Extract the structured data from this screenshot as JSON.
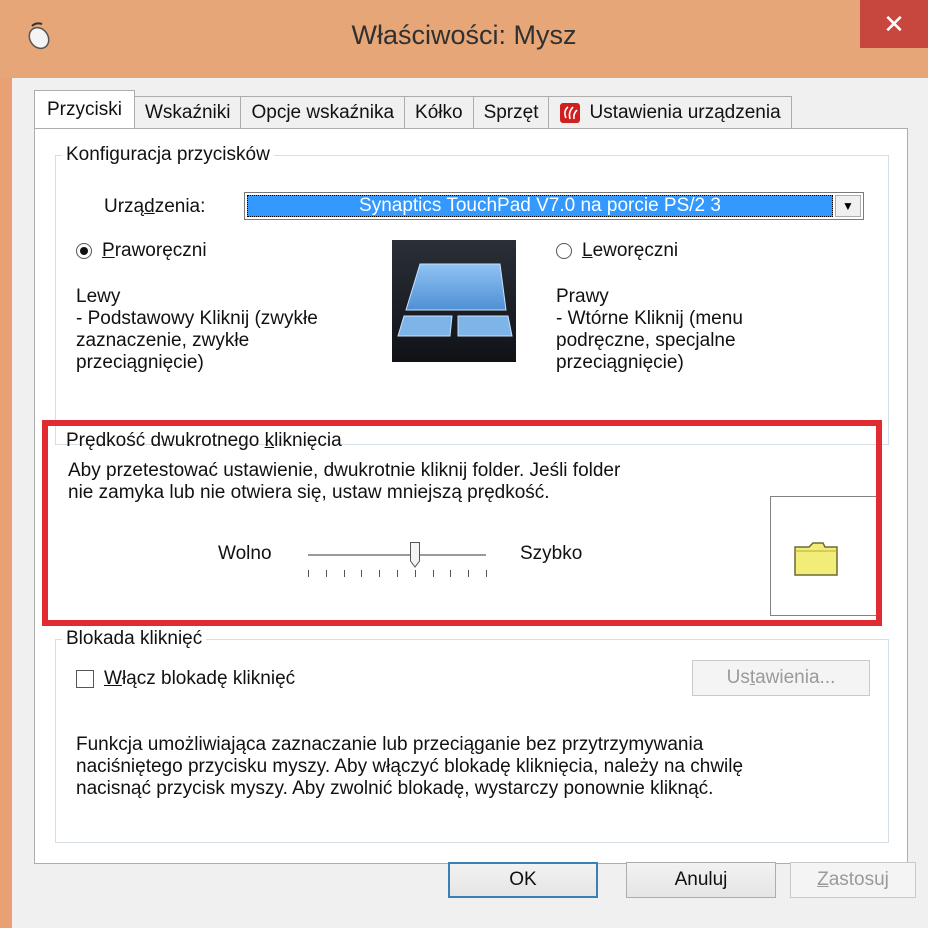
{
  "window": {
    "title": "Właściwości: Mysz",
    "close_glyph": "✕"
  },
  "tabs": [
    {
      "label": "Przyciski",
      "active": true
    },
    {
      "label": "Wskaźniki",
      "active": false
    },
    {
      "label": "Opcje wskaźnika",
      "active": false
    },
    {
      "label": "Kółko",
      "active": false
    },
    {
      "label": "Sprzęt",
      "active": false
    },
    {
      "label": "Ustawienia urządzenia",
      "active": false,
      "icon": "synaptics-icon"
    }
  ],
  "button_config": {
    "group_label": "Konfiguracja przycisków",
    "device_label_pre": "Urzą",
    "device_label_u": "d",
    "device_label_post": "zenia:",
    "device_value": "Synaptics TouchPad V7.0 na porcie PS/2 3",
    "right_handed_u": "P",
    "right_handed_rest": "raworęczni",
    "left_handed_u": "L",
    "left_handed_rest": "eworęczni",
    "right_handed_selected": true,
    "left_title": "Lewy",
    "left_desc_1": " - Podstawowy Kliknij (zwykłe",
    "left_desc_2": "zaznaczenie, zwykłe",
    "left_desc_3": "przeciągnięcie)",
    "right_title": "Prawy",
    "right_desc_1": " - Wtórne Kliknij (menu",
    "right_desc_2": "podręczne, specjalne",
    "right_desc_3": "przeciągnięcie)"
  },
  "double_click": {
    "group_label_pre": "Prędkość dwukrotnego ",
    "group_label_u": "k",
    "group_label_post": "liknięcia",
    "desc_1": "Aby przetestować ustawienie, dwukrotnie kliknij folder. Jeśli folder",
    "desc_2": "nie zamyka lub nie otwiera się, ustaw mniejszą prędkość.",
    "slow_label": "Wolno",
    "fast_label": "Szybko",
    "speed_fraction": 0.6,
    "highlight_color": "#e02b30"
  },
  "click_lock": {
    "group_label": "Blokada kliknięć",
    "checkbox_u": "W",
    "checkbox_rest": "łącz blokadę kliknięć",
    "checked": false,
    "settings_pre": "Us",
    "settings_u": "t",
    "settings_post": "awienia...",
    "desc_1": "Funkcja umożliwiająca zaznaczanie lub przeciąganie bez przytrzymywania",
    "desc_2": "naciśniętego przycisku myszy. Aby włączyć blokadę kliknięcia, należy na chwilę",
    "desc_3": "nacisnąć przycisk myszy. Aby zwolnić blokadę, wystarczy ponownie kliknąć."
  },
  "footer": {
    "ok": "OK",
    "cancel": "Anuluj",
    "apply_u": "Z",
    "apply_rest": "astosuj"
  }
}
